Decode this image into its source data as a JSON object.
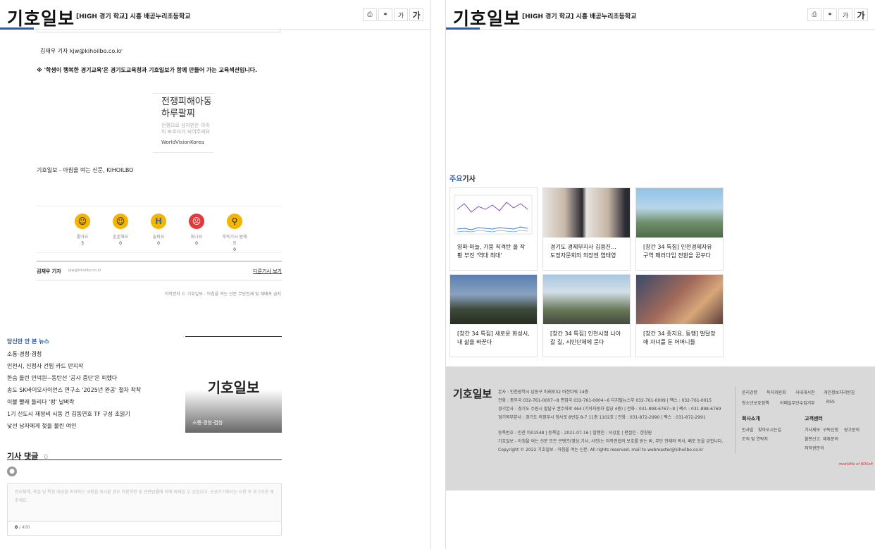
{
  "header": {
    "logo": "기호일보",
    "article_title": "[HIGH 경기 학교] 시흥 배곧누리초등학교",
    "font_small": "가",
    "font_large": "가"
  },
  "article": {
    "reporter_line": "김재우 기자 kjw@kihoilbo.co.kr",
    "notice": "※ '학생이 행복한 경기교육'은 경기도교육청과 기호일보가 함께 만들어 가는 교육섹션입니다.",
    "ad_title": "전쟁피해아동 하루팔찌",
    "ad_body": "전쟁으로 상처받은 아이의 보호자가 되어주세요",
    "ad_brand": "WorldVisionKorea",
    "slogan": "기호일보 - 아침을 여는 신문, KIHOILBO",
    "reactions": [
      {
        "label": "좋아요",
        "count": "3",
        "icon": "smile-emoji-icon",
        "color": "#f5b400"
      },
      {
        "label": "훈훈해요",
        "count": "0",
        "icon": "laugh-emoji-icon",
        "color": "#f5b400"
      },
      {
        "label": "슬퍼요",
        "count": "0",
        "icon": "sad-emoji-icon",
        "color": "#f5b400"
      },
      {
        "label": "화나요",
        "count": "0",
        "icon": "angry-emoji-icon",
        "color": "#e03a3a"
      },
      {
        "label": "후속기사 원해요",
        "count": "0",
        "icon": "search-emoji-icon",
        "color": "#f5b400"
      }
    ],
    "byline_name": "김재우 기자",
    "byline_email": "kjw@kihoilbo.co.kr",
    "more_articles": "다른기사 보기",
    "copyright": "저작권자 © 기호일보 - 아침을 여는 신문 무단전재 및 재배포 금지"
  },
  "missed_news": {
    "title": "당신만 안 본 뉴스",
    "items": [
      "소통·경청·겸청",
      "인천시, 신청사 건립 카드 만지작",
      "한숨 돌린 인덕원~동탄선 '공사 중단'은 피했다",
      "송도 SK바이오사이언스 연구소 '2025년 완공' 절차 착착",
      "이불 빨래 돌리다 '펑' 날벼락",
      "1기 신도시 재정비 시동 건 김동연호 TF 구성 초읽기",
      "낯선 남자에게 젖을 물린 여인"
    ],
    "feature_logo": "기호일보",
    "feature_caption": "소통·경청·겸청"
  },
  "comments": {
    "title": "기사 댓글",
    "count": "0",
    "placeholder": "관리체계, 욕설 및 특정 대상을 비하하는 내용을 게시할 경우 이용약관 및 관련법률에 의해 제재될 수 있습니다. 공공기기에서는 사용 후 로그아웃 해주세요.",
    "counter_current": "0",
    "counter_max": "/ 400"
  },
  "main_articles": {
    "title_accent": "주요",
    "title_rest": "기사",
    "cards": [
      "양파·마늘, 가뭄 직격탄 올 작황 부진 '역대 최대'",
      "경기도 경제부지사 김용진... 도정자문회의 의장엔 염태영",
      "[창간 34 특집] 인천경제자유구역 패러다임 전환을 꿈꾸다",
      "[창간 34 특집] 새로운 화성시, 내 삶을 바꾼다",
      "[창간 34 특집] 인천시정 나아갈 길, 시민단체에 묻다",
      "[창간 34 종지요, 동행] 발달장애 자녀를 둔 어머니들"
    ]
  },
  "footer": {
    "logo": "기호일보",
    "lines": [
      "본사 : 인천광역시 남동구 미래로32 비전타워 14층",
      "전화 : 총무국 032-761-0007~8 편집국 032-761-0004~6 디지털뉴스부 032-761-0009 | 팩스 : 032-761-0015",
      "경기본사 : 경기도 수원시 팔달구 권수마로 464 (기아자동차 빌딩 4층) | 전화 : 031-898-6767~8 | 팩스 : 031-898-6769",
      "경기북부본사 : 경기도 의정부시 청사로 8번길 8-7 11층 1102호 | 전화 : 031-872-2990 | 팩스 : 031-872-2991",
      "등록번호 : 인천 아01548 | 등록일 : 2021-07-16 | 발행인 : 서강훈 | 편집인 : 한창원",
      "기호일보 - 아침을 여는 신문 모든 콘텐츠(영상,기사, 사진)는 저작권법의 보호를 받는 바, 무단 전재와 복사, 배포 등을 금합니다.",
      "Copyright © 2022 기호일보 - 아침을 여는 신문. All rights reserved. mail to webmaster@kihoilbo.co.kr"
    ],
    "links_top": [
      "윤리강령",
      "독자위원회",
      "사내게시판",
      "개인정보처리방침",
      "청소년보호정책",
      "이메일무단수집거부",
      "RSS"
    ],
    "company_title": "회사소개",
    "company_links": [
      "인사말",
      "찾아오시는길",
      "조직 및 연락처"
    ],
    "service_title": "고객센터",
    "service_links": [
      "기사제보",
      "구독신청",
      "광고문의",
      "불편신고",
      "제휴문의",
      "저작권문의"
    ],
    "credit": "mediaMe of NDSoft"
  }
}
